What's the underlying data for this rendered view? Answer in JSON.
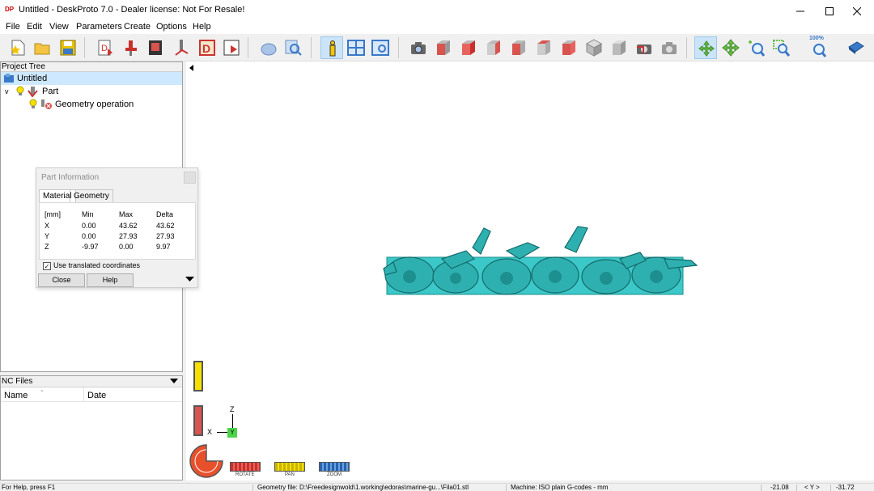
{
  "window": {
    "app_icon": "DP",
    "title": "Untitled - DeskProto 7.0 - Dealer license: Not For Resale!",
    "minimize_icon": "minimize-icon",
    "maximize_icon": "maximize-icon",
    "close_icon": "close-icon"
  },
  "menu": [
    "File",
    "Edit",
    "View",
    "Parameters",
    "Create",
    "Options",
    "Help"
  ],
  "toolbar": {
    "zoom_100": "100%",
    "icons": [
      "new-project-icon",
      "open-project-icon",
      "save-project-icon",
      "part-parameters-icon",
      "operation-parameters-icon",
      "machine-parameters-icon",
      "tool-icon",
      "drill-icon",
      "write-nc-icon",
      "simulate-icon",
      "preview-icon",
      "info-icon",
      "layout-icon",
      "viewport-icon",
      "render-icon",
      "view-front-icon",
      "view-back-icon",
      "view-left-icon",
      "view-right-icon",
      "view-top-icon",
      "view-bottom-icon",
      "view-iso-icon",
      "view-side-icon",
      "refresh-view-icon",
      "previous-view-icon",
      "rotate-icon",
      "pan-icon",
      "zoom-icon",
      "zoom-window-icon",
      "zoom-100-icon",
      "help-book-icon"
    ]
  },
  "project_tree": {
    "header": "Project Tree",
    "root": "Untitled",
    "part": "Part",
    "operation": "Geometry operation"
  },
  "part_info": {
    "title": "Part Information",
    "tabs": [
      "Material",
      "Geometry"
    ],
    "columns": [
      "[mm]",
      "Min",
      "Max",
      "Delta"
    ],
    "rows": [
      [
        "X",
        "0.00",
        "43.62",
        "43.62"
      ],
      [
        "Y",
        "0.00",
        "27.93",
        "27.93"
      ],
      [
        "Z",
        "-9.97",
        "0.00",
        "9.97"
      ]
    ],
    "checkbox_label": "Use translated coordinates",
    "checkbox_checked": true,
    "close_label": "Close",
    "help_label": "Help"
  },
  "nc_files": {
    "header": "NC Files",
    "col_name": "Name",
    "col_date": "Date"
  },
  "viewport": {
    "axis_z": "Z",
    "axis_x": "X",
    "axis_y": "Y",
    "model_color": "#3cc8c8",
    "mode_buttons": [
      "ROTATE",
      "PAN",
      "ZOOM"
    ]
  },
  "status": {
    "help": "For Help, press F1",
    "geometry_file": "Geometry file: D:\\Freedesignwold\\1.working\\edoras\\marine-gu...\\Fila01.stl",
    "machine": "Machine: ISO plain G-codes - mm",
    "coord_x": "-21.08",
    "coord_axis": "< Y >",
    "coord_y": "-31.72"
  }
}
